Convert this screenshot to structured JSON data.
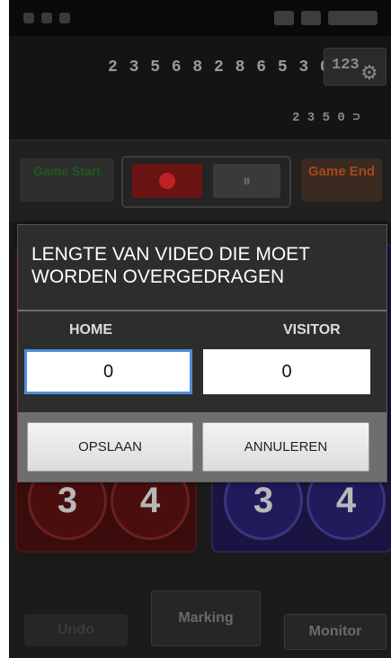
{
  "dialog": {
    "title": "LENGTE VAN VIDEO DIE MOET WORDEN OVERGEDRAGEN",
    "home_label": "HOME",
    "visitor_label": "VISITOR",
    "home_value": "0",
    "visitor_value": "0",
    "save_label": "OPSLAAN",
    "cancel_label": "ANNULEREN"
  },
  "header": {
    "timecode": "2 3 5 6 8 2 8 6 5 3 0",
    "settings_number": "123",
    "battery_text": "2 3 5 0 ⊃"
  },
  "controls": {
    "game_start_label": "Game Start",
    "pause_icon": "⏸",
    "game_end_label": "Game End"
  },
  "home_panel": {
    "buttons": [
      "3",
      "4"
    ]
  },
  "visitor_panel": {
    "buttons": [
      "3",
      "4"
    ]
  },
  "bottom": {
    "undo_label": "Undo",
    "marking_label": "Marking",
    "monitor_label": "Monitor"
  },
  "colors": {
    "dialog_bg": "#2d2d2d",
    "input_focus": "#4f8ed8",
    "home_panel": "#3a0c0c",
    "visitor_panel": "#1a1540"
  },
  "icons": [
    "gear-icon",
    "record-icon",
    "pause-icon",
    "battery-icon"
  ]
}
